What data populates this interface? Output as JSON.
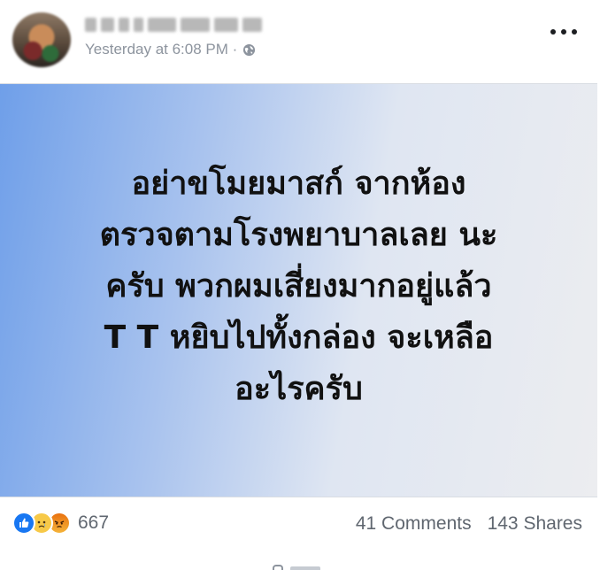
{
  "header": {
    "timestamp": "Yesterday at 6:08 PM ·",
    "privacy_icon": "globe-icon",
    "more_icon": "more-options-icon"
  },
  "post": {
    "text": "อย่าขโมยมาสก์ จากห้อง\nตรวจตามโรงพยาบาลเลย นะ\nครับ พวกผมเสี่ยงมากอยู่แล้ว\nT T หยิบไปทั้งกล่อง จะเหลือ\nอะไรครับ",
    "background_gradient": [
      "#6f9fe9",
      "#ecedf0"
    ]
  },
  "footer": {
    "reaction_icons": [
      "like-icon",
      "sad-icon",
      "angry-icon"
    ],
    "reaction_count": "667",
    "comments": "41 Comments",
    "shares": "143 Shares"
  },
  "colors": {
    "like": "#1877f2",
    "meta_text": "#8d949e",
    "footer_text": "#606770"
  }
}
